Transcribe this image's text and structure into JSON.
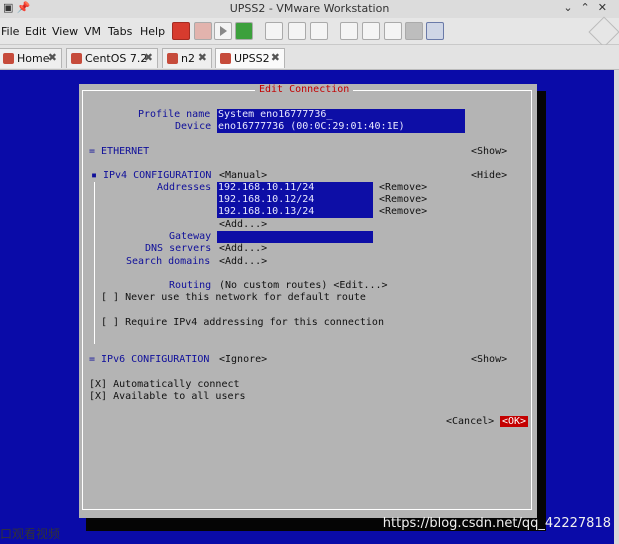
{
  "window": {
    "title": "UPSS2 - VMware Workstation"
  },
  "menu": [
    "File",
    "Edit",
    "View",
    "VM",
    "Tabs",
    "Help"
  ],
  "tabs": [
    {
      "label": "Home"
    },
    {
      "label": "CentOS 7.2"
    },
    {
      "label": "n2"
    },
    {
      "label": "UPSS2"
    }
  ],
  "dialog": {
    "title": "Edit Connection",
    "profile_name_label": "Profile name",
    "profile_name_value": "System eno16777736_",
    "device_label": "Device",
    "device_value": "eno16777736 (00:0C:29:01:40:1E)",
    "ethernet_label": "= ETHERNET",
    "ethernet_action": "<Show>",
    "ipv4_label": "IPv4 CONFIGURATION",
    "ipv4_mode": "<Manual>",
    "ipv4_action": "<Hide>",
    "addresses_label": "Addresses",
    "addresses": [
      "192.168.10.11/24",
      "192.168.10.12/24",
      "192.168.10.13/24"
    ],
    "remove_label": "<Remove>",
    "add_label": "<Add...>",
    "gateway_label": "Gateway",
    "dns_label": "DNS servers",
    "search_label": "Search domains",
    "routing_label": "Routing",
    "routing_value": "(No custom routes) <Edit...>",
    "never_default": "[ ] Never use this network for default route",
    "require_ipv4": "[ ] Require IPv4 addressing for this connection",
    "ipv6_label": "= IPv6 CONFIGURATION",
    "ipv6_mode": "<Ignore>",
    "ipv6_action": "<Show>",
    "auto_connect": "[X] Automatically connect",
    "all_users": "[X] Available to all users",
    "cancel": "<Cancel>",
    "ok": "<OK>"
  },
  "watermark": "https://blog.csdn.net/qq_42227818",
  "bottom_text": "口观看视频"
}
